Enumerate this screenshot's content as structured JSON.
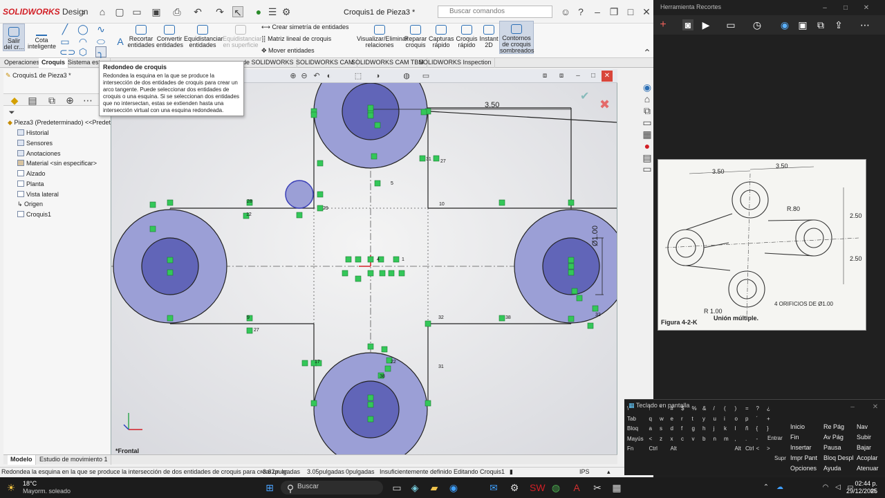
{
  "app": {
    "logo_brand": "SOLIDWORKS",
    "logo_suffix": "Design",
    "doc_title": "Croquis1 de Pieza3 *",
    "search_placeholder": "Buscar comandos"
  },
  "ribbon": {
    "items": [
      "Salir del cr...",
      "Cota inteligente",
      "Recortar entidades",
      "Convertir entidades",
      "Equidistanciar entidades",
      "Equidistanciar en superficie",
      "Visualizar/Eliminar relaciones",
      "Reparar croquis",
      "Capturas rápido",
      "Croquis rápido",
      "Instant 2D",
      "Contornos de croquis sombreados"
    ],
    "mirror": "Crear simetría de entidades",
    "linear_pattern": "Matriz lineal de croquis",
    "move": "Mover entidades"
  },
  "tabs": [
    "Operaciones",
    "Croquis",
    "Sistema estr...",
    "s de SOLIDWORKS",
    "SOLIDWORKS CAM",
    "SOLIDWORKS CAM TBM",
    "SOLIDWORKS Inspection"
  ],
  "tooltip": {
    "title": "Redondeo de croquis",
    "body": "Redondea la esquina en la que se produce la intersección de dos entidades de croquis para crear un arco tangente. Puede seleccionar dos entidades de croquis o una esquina. Si se seleccionan dos entidades que no intersectan, estas se extienden hasta una intersección virtual con una esquina redondeada."
  },
  "feature_manager": {
    "tab_title": "Croquis1 de Pieza3 *",
    "root": "Pieza3 (Predeterminado) <<Predeterm",
    "items": [
      "Historial",
      "Sensores",
      "Anotaciones",
      "Material <sin especificar>",
      "Alzado",
      "Planta",
      "Vista lateral",
      "Origen",
      "Croquis1"
    ]
  },
  "canvas": {
    "dim_350": "3.50",
    "dim_100": "Ø1.00",
    "view_label": "*Frontal",
    "relations": [
      "28",
      "12",
      "29",
      "5",
      "31",
      "27",
      "38",
      "32",
      "9",
      "17",
      "22",
      "31",
      "27",
      "38",
      "32",
      "4",
      "1",
      "10"
    ]
  },
  "bottom_tabs": [
    "Modelo",
    "Estudio de movimiento 1"
  ],
  "status": {
    "hint": "Redondea la esquina en la que se produce la intersección de dos entidades de croquis para crear un ar...",
    "x": "-3.62pulgadas",
    "y": "3.05pulgadas",
    "z": "0pulgadas",
    "state": "Insuficientemente definido",
    "editing": "Editando Croquis1",
    "units": "IPS"
  },
  "snip": {
    "title": "Herramienta Recortes"
  },
  "figure": {
    "dims": [
      "3.50",
      "3.50",
      "2.50",
      "2.50"
    ],
    "r80": "R.80",
    "r100": "R 1.00",
    "holes": "4 ORIFICIOS DE Ø1.00",
    "caption": "Figura 4-2-K",
    "caption2": "Unión múltiple."
  },
  "osk": {
    "title": "Teclado en pantalla",
    "rows": [
      [
        "\\",
        "!",
        "\"",
        "#",
        "$",
        "%",
        "&",
        "/",
        "(",
        ")",
        "=",
        "?",
        "¿"
      ],
      [
        "Tab",
        "q",
        "w",
        "e",
        "r",
        "t",
        "y",
        "u",
        "i",
        "o",
        "p",
        "´",
        "+"
      ],
      [
        "Bloq",
        "a",
        "s",
        "d",
        "f",
        "g",
        "h",
        "j",
        "k",
        "l",
        "ñ",
        "{",
        "}"
      ],
      [
        "Mayús",
        "<",
        "z",
        "x",
        "c",
        "v",
        "b",
        "n",
        "m",
        ",",
        ".",
        "-"
      ],
      [
        "Fn",
        "Ctrl",
        "",
        "Alt",
        "",
        "",
        "",
        "",
        "",
        "Alt",
        "Ctrl",
        "<",
        ">"
      ]
    ],
    "right": [
      [
        "Inicio",
        "Re Pág",
        "Nav"
      ],
      [
        "Fin",
        "Av Pág",
        "Subir"
      ],
      [
        "Insertar",
        "Pausa",
        "Bajar"
      ],
      [
        "Impr Pant",
        "Bloq Despl",
        "Acoplar"
      ],
      [
        "Opciones",
        "Ayuda",
        "Atenuar"
      ]
    ],
    "special": [
      "Entrar",
      "Supr"
    ]
  },
  "taskbar": {
    "temp": "18°C",
    "weather": "Mayorm. soleado",
    "search": "Buscar",
    "time": "02:44 p. m.",
    "date": "29/12/2025"
  },
  "colors": {
    "accent": "#2c6fb5",
    "sketch_fill": "#9b9fd6",
    "sketch_inner": "#6165b8",
    "relation": "#34c759",
    "brand": "#d21f26"
  }
}
